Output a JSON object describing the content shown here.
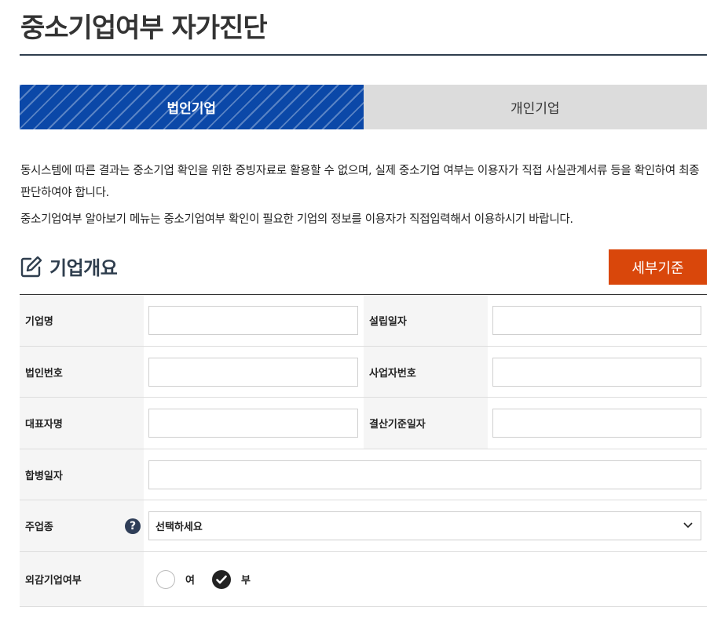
{
  "page": {
    "title": "중소기업여부 자가진단"
  },
  "tabs": [
    {
      "label": "법인기업",
      "active": true
    },
    {
      "label": "개인기업",
      "active": false
    }
  ],
  "notice": {
    "line1": "동시스템에 따른 결과는 중소기업 확인을 위한 증빙자료로 활용할 수 없으며, 실제 중소기업 여부는 이용자가 직접 사실관계서류 등을 확인하여 최종 판단하여야 합니다.",
    "line2": "중소기업여부 알아보기 메뉴는 중소기업여부 확인이 필요한 기업의 정보를 이용자가 직접입력해서 이용하시기 바랍니다."
  },
  "section": {
    "title": "기업개요",
    "icon": "edit-icon",
    "criteria_button": "세부기준"
  },
  "form": {
    "company_name": {
      "label": "기업명",
      "value": ""
    },
    "founding_date": {
      "label": "설립일자",
      "value": ""
    },
    "corp_number": {
      "label": "법인번호",
      "value": ""
    },
    "business_number": {
      "label": "사업자번호",
      "value": ""
    },
    "ceo_name": {
      "label": "대표자명",
      "value": ""
    },
    "settlement_date": {
      "label": "결산기준일자",
      "value": ""
    },
    "merger_date": {
      "label": "합병일자",
      "value": ""
    },
    "main_industry": {
      "label": "주업종",
      "help_icon": "?",
      "selected": "선택하세요"
    },
    "external_audit": {
      "label": "외감기업여부",
      "options": [
        {
          "label": "여",
          "checked": false
        },
        {
          "label": "부",
          "checked": true
        }
      ]
    }
  },
  "colors": {
    "tab_active": "#0b48a8",
    "tab_inactive": "#dcdcdc",
    "accent_button": "#d9470b",
    "title_rule": "#2f3e4e"
  }
}
